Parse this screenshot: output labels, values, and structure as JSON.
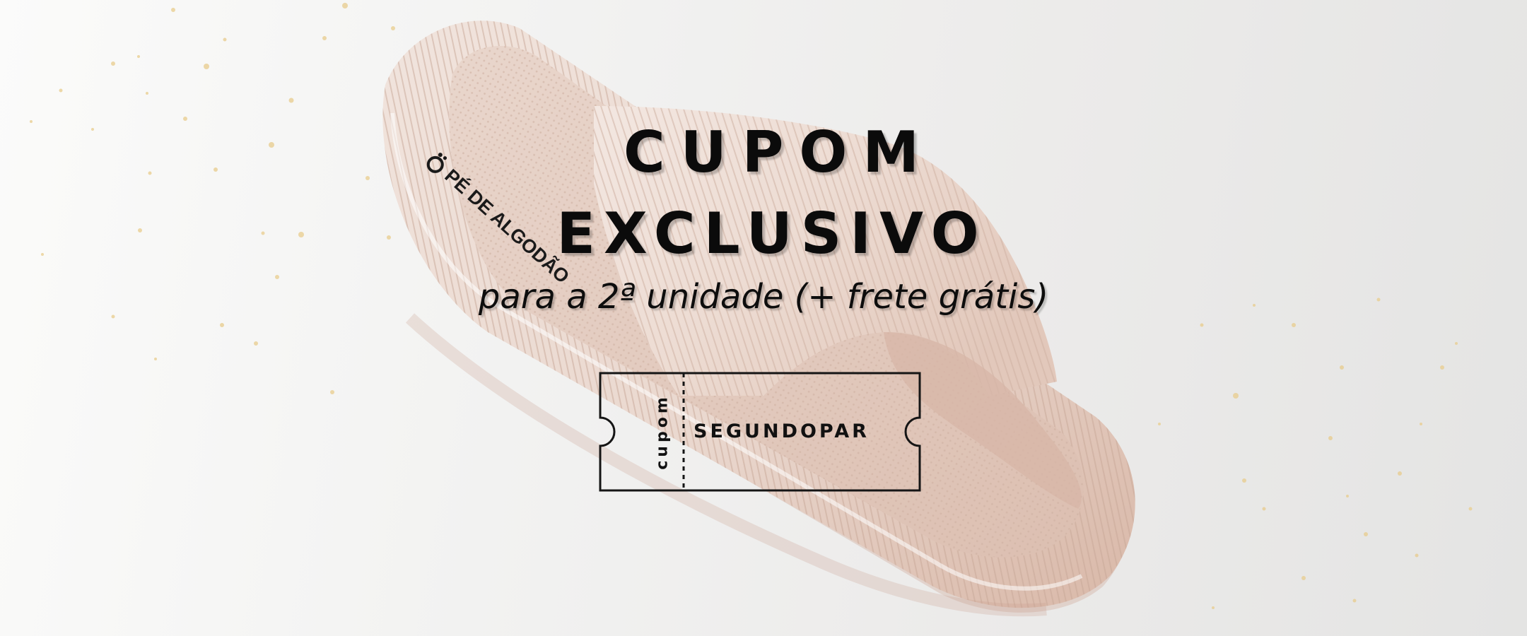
{
  "banner": {
    "headline_line1": "CUPOM",
    "headline_line2": "EXCLUSIVO",
    "subheadline": "para a 2ª unidade (+ frete grátis)"
  },
  "coupon": {
    "label": "cupom",
    "code": "SEGUNDOPAR"
  },
  "product": {
    "brand": "PÉ DE ALGODÃO",
    "icon": "brand-logo-icon"
  },
  "colors": {
    "text": "#0b0b0b",
    "slipper": "#eeddd5",
    "slipper_shadow": "#c9a99b",
    "glitter": "#e6c98a"
  }
}
